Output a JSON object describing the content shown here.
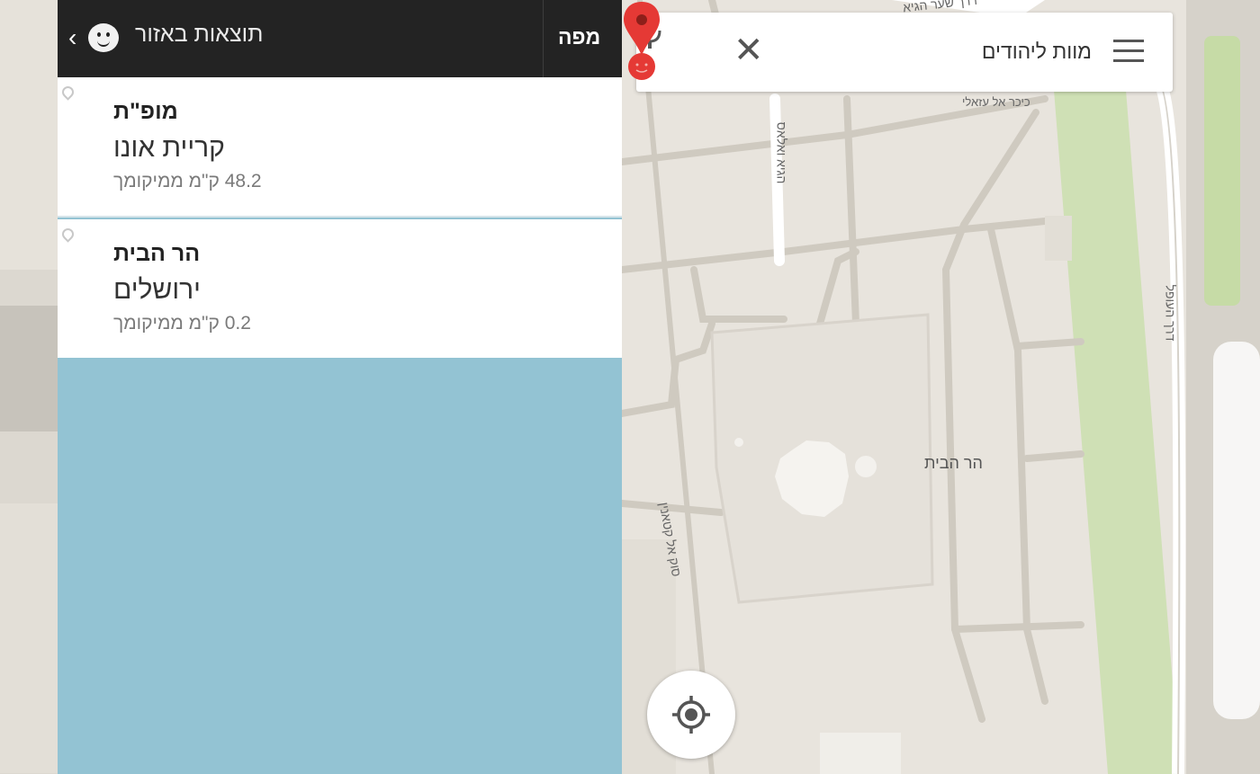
{
  "left_panel": {
    "back_label": "‹",
    "title": "תוצאות באזור",
    "map_button": "מפה",
    "results": [
      {
        "name": "מופ\"ת",
        "city": "קריית אונו",
        "distance": "48.2 ק\"מ ממיקומך"
      },
      {
        "name": "הר הבית",
        "city": "ירושלים",
        "distance": "0.2 ק\"מ ממיקומך"
      }
    ]
  },
  "map": {
    "search": {
      "query": "מוות ליהודים",
      "clear_label": "✕"
    },
    "marker_label": "הר הבית",
    "streets": {
      "top": "דרך שער הגיא",
      "street2": "כיכר אל עזאלי",
      "street3": "הגיא ואלאס",
      "street4": "סוק אל קטאנין",
      "street5": "דרך העופל"
    }
  },
  "colors": {
    "topbar": "#232323",
    "panel_bg": "#93c3d3",
    "map_bg": "#e8e4dd",
    "pin": "#e53935"
  }
}
